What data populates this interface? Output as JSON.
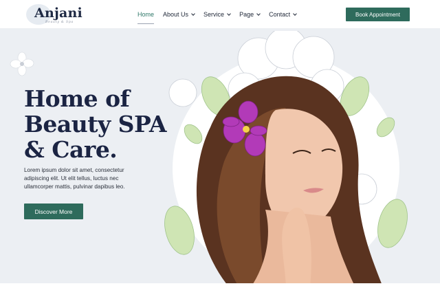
{
  "brand": {
    "name": "Anjani",
    "tagline": "Beauty & Spa"
  },
  "nav": {
    "items": [
      {
        "label": "Home",
        "active": true,
        "has_dropdown": false
      },
      {
        "label": "About Us",
        "active": false,
        "has_dropdown": true
      },
      {
        "label": "Service",
        "active": false,
        "has_dropdown": true
      },
      {
        "label": "Page",
        "active": false,
        "has_dropdown": true
      },
      {
        "label": "Contact",
        "active": false,
        "has_dropdown": true
      }
    ],
    "cta_label": "Book Appointment"
  },
  "hero": {
    "title_lines": [
      "Home of",
      "Beauty SPA",
      "& Care."
    ],
    "body": "Lorem ipsum dolor sit amet, consectetur adipiscing elit. Ut elit tellus, luctus nec ullamcorper mattis, pulvinar dapibus leo.",
    "button_label": "Discover More"
  },
  "colors": {
    "accent": "#2e6b5c",
    "active_link": "#2e7768",
    "heading": "#1b2443",
    "hero_bg": "#eceff3",
    "orchid": "#b23ab8"
  },
  "icons": {
    "chevron": "chevron-down-icon"
  }
}
